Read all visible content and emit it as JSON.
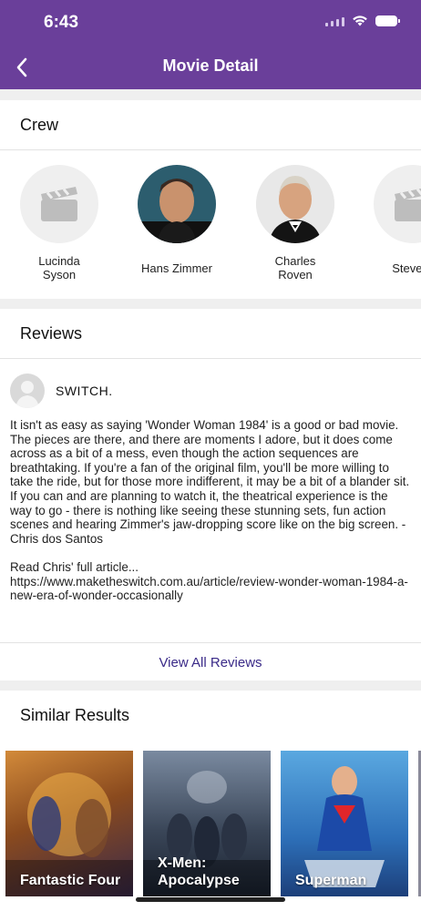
{
  "status": {
    "time": "6:43"
  },
  "nav": {
    "title": "Movie Detail",
    "back_icon": "chevron-left-icon"
  },
  "crew": {
    "heading": "Crew",
    "members": [
      {
        "name": "Lucinda\nSyson",
        "avatar": "clapperboard-icon"
      },
      {
        "name": "Hans Zimmer",
        "avatar": "photo"
      },
      {
        "name": "Charles\nRoven",
        "avatar": "photo"
      },
      {
        "name": "Steve P",
        "avatar": "clapperboard-icon"
      }
    ]
  },
  "reviews": {
    "heading": "Reviews",
    "items": [
      {
        "author": "SWITCH.",
        "text": "It isn't as easy as saying 'Wonder Woman 1984' is a good or bad movie. The pieces are there, and there are moments I adore, but it does come across as a bit of a mess, even though the action sequences are breathtaking. If you're a fan of the original film, you'll be more willing to take the ride, but for those more indifferent, it may be a bit of a blander sit. If you can and are planning to watch it, the theatrical experience is the way to go - there is nothing like seeing these stunning sets, fun action scenes and hearing Zimmer's jaw-dropping score like on the big screen. - Chris dos Santos\n\nRead Chris' full article...\nhttps://www.maketheswitch.com.au/article/review-wonder-woman-1984-a-new-era-of-wonder-occasionally"
      }
    ],
    "view_all": "View All Reviews"
  },
  "similar": {
    "heading": "Similar Results",
    "items": [
      {
        "title": "Fantastic Four"
      },
      {
        "title": "X-Men:\nApocalypse"
      },
      {
        "title": "Superman"
      }
    ]
  },
  "colors": {
    "brand": "#6a3f9a",
    "link": "#3a2a88"
  }
}
